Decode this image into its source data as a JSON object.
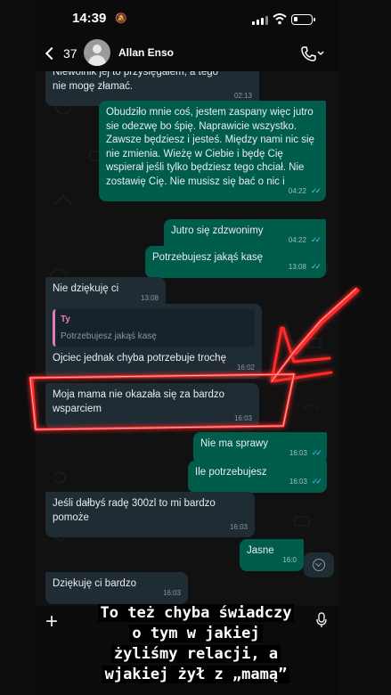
{
  "status_bar": {
    "time": "14:39",
    "battery_level": 0.2
  },
  "header": {
    "back_count": "37",
    "contact_name": "Allan Enso"
  },
  "messages": [
    {
      "dir": "in",
      "text": "Niewolnik jej to przysięgałem, a tego\nnie mogę złamać.",
      "time": "02:13"
    },
    {
      "dir": "out",
      "text": "Obudziło mnie coś, jestem zaspany więc jutro sie odezwę bo śpię. Naprawicie wszystko. Zawsze będziesz i jesteś. Między nami nic się nie zmienia. Wieżę w Ciebie i będę Cię wspierał jeśli tylko będziesz tego chciał. Nie zostawię Cię. Nie musisz się bać o nic i",
      "time": "04:22",
      "read": true
    },
    {
      "dir": "out",
      "text": "Jutro się zdzwonimy",
      "time": "04:22",
      "read": true
    },
    {
      "dir": "out",
      "text": "Potrzebujesz jakąś kasę",
      "time": "13:08",
      "read": true
    },
    {
      "dir": "in",
      "text": "Nie dziękuję ci",
      "time": "13:08"
    },
    {
      "dir": "in",
      "quote_author": "Ty",
      "quote_text": "Potrzebujesz jakąś kasę",
      "text": "Ojciec jednak chyba potrzebuje trochę",
      "time": "16:02"
    },
    {
      "dir": "in",
      "text": "Moja mama nie okazała się za bardzo wsparciem",
      "time": "16:03"
    },
    {
      "dir": "out",
      "text": "Nie ma sprawy",
      "time": "16:03",
      "read": true
    },
    {
      "dir": "out",
      "text": "Ile potrzebujesz",
      "time": "16:03",
      "read": true
    },
    {
      "dir": "in",
      "text": "Jeśli dałbyś radę 300zl to mi bardzo pomoże",
      "time": "16:03"
    },
    {
      "dir": "out",
      "text": "Jasne",
      "time": "16:0",
      "read": false
    },
    {
      "dir": "in",
      "text": "Dziękuję ci bardzo",
      "time": "16:03"
    }
  ],
  "caption": {
    "lines": [
      "To też chyba świadczy",
      "o tym w jakiej",
      "żyliśmy relacji, a",
      "wjakiej żył z „mamą”"
    ]
  },
  "colors": {
    "incoming": "#1f2c34",
    "outgoing": "#005c4b",
    "highlight": "#ff1a1a"
  }
}
